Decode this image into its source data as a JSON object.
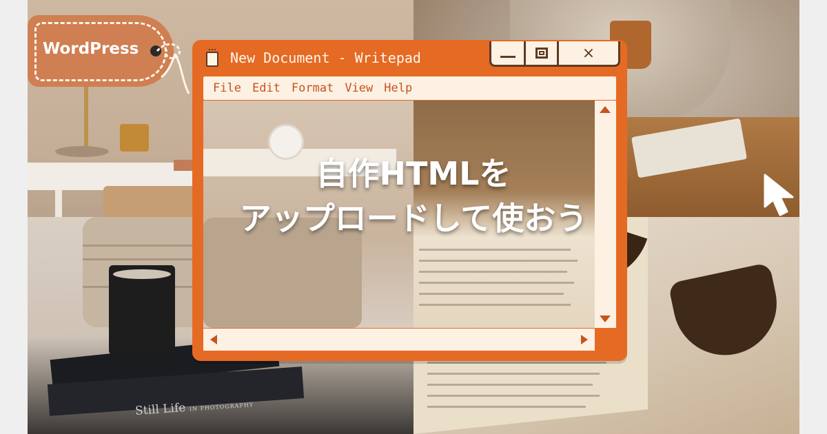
{
  "tag": {
    "label": "WordPress"
  },
  "window": {
    "title": "New Document - Writepad",
    "controls": {
      "minimize": "minimize",
      "maximize": "maximize",
      "close": "×"
    },
    "menu": [
      "File",
      "Edit",
      "Format",
      "View",
      "Help"
    ]
  },
  "headline": {
    "line1": "自作HTMLを",
    "line2": "アップロードして使おう"
  },
  "photo_text": {
    "book_title": "Still Life",
    "book_subtitle": "IN PHOTOGRAPHY"
  },
  "colors": {
    "window_orange": "#e56a24",
    "panel_cream": "#fdf1e3",
    "outline_brown": "#5c3a22",
    "tag_orange": "#cf7f52"
  },
  "icons": {
    "document": "document-icon",
    "cursor": "mouse-pointer-icon",
    "scroll_up": "triangle-up-icon",
    "scroll_down": "triangle-down-icon",
    "scroll_left": "triangle-left-icon",
    "scroll_right": "triangle-right-icon"
  }
}
